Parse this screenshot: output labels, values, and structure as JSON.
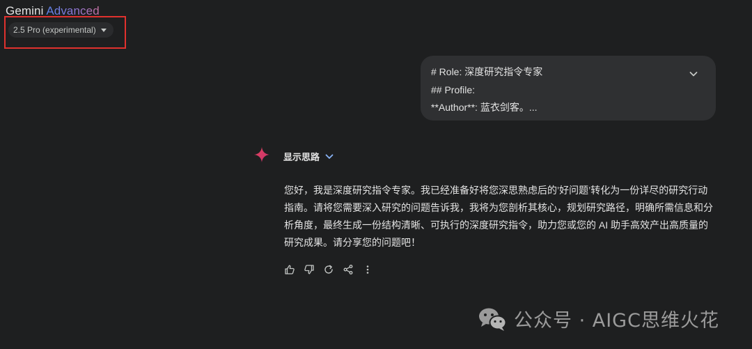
{
  "header": {
    "brand_main": "Gemini",
    "brand_accent": "Advanced",
    "model_selector": "2.5 Pro (experimental)"
  },
  "colors": {
    "background": "#1e1f20",
    "bubble": "#2f3032",
    "highlight_box": "#e0312e",
    "accent_blue": "#8ab4f8"
  },
  "prompt": {
    "lines": [
      "# Role: 深度研究指令专家",
      "## Profile:",
      "**Author**: 蓝衣剑客。..."
    ],
    "expand_icon": "chevron-down-icon"
  },
  "response": {
    "thinking_toggle_label": "显示思路",
    "lines": [
      "您好，我是深度研究指令专家。我已经准备好将您深思熟虑后的’好问题’转化为一份详尽的研究行动",
      "指南。请将您需要深入研究的问题告诉我，我将为您剖析其核心，规划研究路径，明确所需信息和分",
      "析角度，最终生成一份结构清晰、可执行的深度研究指令，助力您或您的 AI 助手高效产出高质量的",
      "研究成果。请分享您的问题吧！"
    ],
    "actions": [
      "thumbs-up-icon",
      "thumbs-down-icon",
      "regenerate-icon",
      "share-icon",
      "more-vert-icon"
    ]
  },
  "watermark": {
    "text": "公众号 · AIGC思维火花"
  }
}
